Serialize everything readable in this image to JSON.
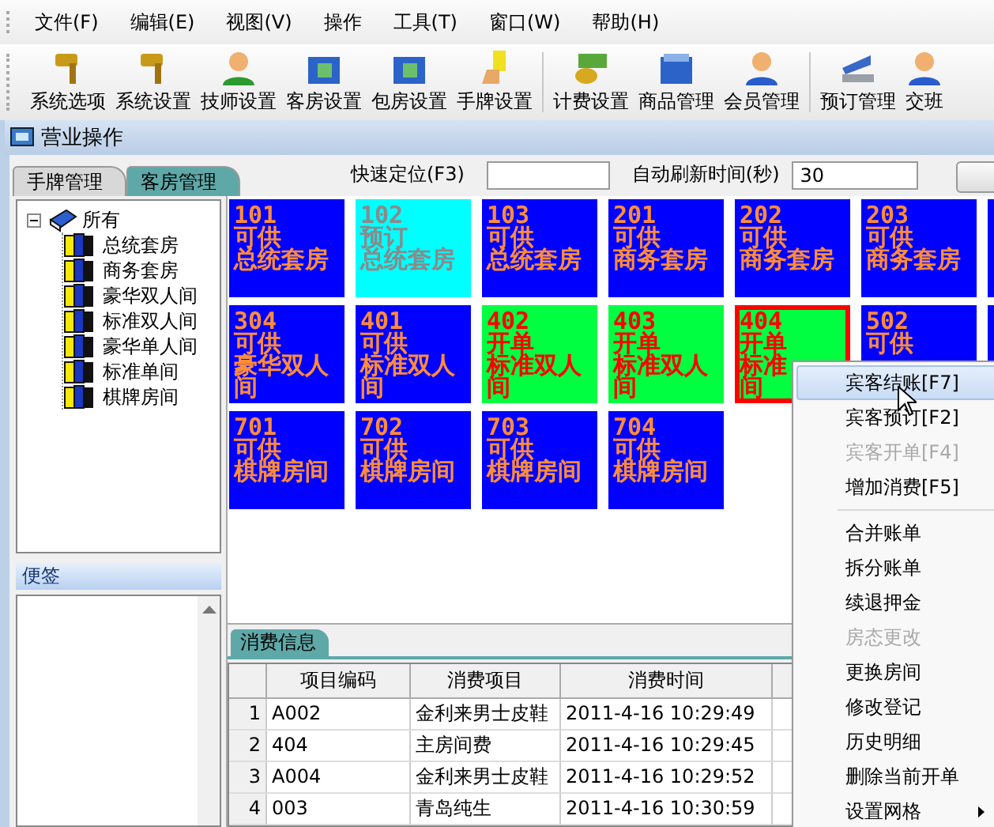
{
  "menu_bar": [
    {
      "label": "文件(F)"
    },
    {
      "label": "编辑(E)"
    },
    {
      "label": "视图(V)"
    },
    {
      "label": "操作"
    },
    {
      "label": "工具(T)"
    },
    {
      "label": "窗口(W)"
    },
    {
      "label": "帮助(H)"
    }
  ],
  "toolbar": [
    {
      "label": "系统选项",
      "separator_before": false
    },
    {
      "label": "系统设置",
      "separator_before": false
    },
    {
      "label": "技师设置",
      "separator_before": false
    },
    {
      "label": "客房设置",
      "separator_before": false
    },
    {
      "label": "包房设置",
      "separator_before": false
    },
    {
      "label": "手牌设置",
      "separator_before": false
    },
    {
      "label": "计费设置",
      "separator_before": true
    },
    {
      "label": "商品管理",
      "separator_before": false
    },
    {
      "label": "会员管理",
      "separator_before": false
    },
    {
      "label": "预订管理",
      "separator_before": true
    },
    {
      "label": "交班",
      "separator_before": false
    }
  ],
  "window": {
    "title": "营业操作"
  },
  "tabs": [
    {
      "label": "手牌管理",
      "selected": false
    },
    {
      "label": "客房管理",
      "selected": true
    }
  ],
  "quick_locate": {
    "label": "快速定位(F3)"
  },
  "auto_refresh": {
    "label": "自动刷新时间(秒)",
    "value": "30"
  },
  "tree": {
    "label": "所有",
    "expanded": true,
    "children": [
      {
        "label": "总统套房"
      },
      {
        "label": "商务套房"
      },
      {
        "label": "豪华双人间"
      },
      {
        "label": "标准双人间"
      },
      {
        "label": "豪华单人间"
      },
      {
        "label": "标准单间"
      },
      {
        "label": "棋牌房间"
      }
    ]
  },
  "notes": {
    "title": "便签"
  },
  "rooms": [
    {
      "lines": [
        "101",
        "可供",
        "总统套房"
      ],
      "kind": "available",
      "selected": false
    },
    {
      "lines": [
        "102",
        "预订",
        "总统套房"
      ],
      "kind": "reserved",
      "selected": false
    },
    {
      "lines": [
        "103",
        "可供",
        "总统套房"
      ],
      "kind": "available",
      "selected": false
    },
    {
      "lines": [
        "201",
        "可供",
        "商务套房"
      ],
      "kind": "available",
      "selected": false
    },
    {
      "lines": [
        "202",
        "可供",
        "商务套房"
      ],
      "kind": "available",
      "selected": false
    },
    {
      "lines": [
        "203",
        "可供",
        "商务套房"
      ],
      "kind": "available",
      "selected": false
    },
    {
      "kind": "available",
      "selected": false
    },
    {
      "lines": [
        "304",
        "可供",
        "豪华双人",
        "间"
      ],
      "kind": "available",
      "selected": false
    },
    {
      "lines": [
        "401",
        "可供",
        "标准双人",
        "间"
      ],
      "kind": "available",
      "selected": false
    },
    {
      "lines": [
        "402",
        "开单",
        "标准双人",
        "间"
      ],
      "kind": "open",
      "selected": false
    },
    {
      "lines": [
        "403",
        "开单",
        "标准双人",
        "间"
      ],
      "kind": "open",
      "selected": false
    },
    {
      "lines": [
        "404",
        "开单",
        "标准",
        "间"
      ],
      "kind": "open",
      "selected": true
    },
    {
      "lines": [
        "502",
        "可供"
      ],
      "kind": "available",
      "selected": false
    },
    {
      "kind": "available",
      "selected": false
    },
    {
      "lines": [
        "701",
        "可供",
        "棋牌房间"
      ],
      "kind": "available",
      "selected": false
    },
    {
      "lines": [
        "702",
        "可供",
        "棋牌房间"
      ],
      "kind": "available",
      "selected": false
    },
    {
      "lines": [
        "703",
        "可供",
        "棋牌房间"
      ],
      "kind": "available",
      "selected": false
    },
    {
      "lines": [
        "704",
        "可供",
        "棋牌房间"
      ],
      "kind": "available",
      "selected": false
    }
  ],
  "consumption": {
    "tab": "消费信息",
    "columns": [
      "项目编码",
      "消费项目",
      "消费时间"
    ],
    "rows": [
      {
        "index": "1",
        "cells": [
          "A002",
          "金利来男士皮鞋",
          "2011-4-16 10:29:49"
        ]
      },
      {
        "index": "2",
        "cells": [
          "404",
          "主房间费",
          "2011-4-16 10:29:45"
        ]
      },
      {
        "index": "3",
        "cells": [
          "A004",
          "金利来男士皮鞋",
          "2011-4-16 10:29:52"
        ]
      },
      {
        "index": "4",
        "cells": [
          "003",
          "青岛纯生",
          "2011-4-16 10:30:59"
        ]
      }
    ]
  },
  "context_menu": [
    {
      "kind": "item",
      "label": "宾客结账[F7]",
      "selected": true,
      "disabled": false,
      "submenu": false
    },
    {
      "kind": "item",
      "label": "宾客预订[F2]",
      "selected": false,
      "disabled": false,
      "submenu": false
    },
    {
      "kind": "item",
      "label": "宾客开单[F4]",
      "selected": false,
      "disabled": true,
      "submenu": false
    },
    {
      "kind": "item",
      "label": "增加消费[F5]",
      "selected": false,
      "disabled": false,
      "submenu": false
    },
    {
      "kind": "separator"
    },
    {
      "kind": "item",
      "label": "合并账单",
      "selected": false,
      "disabled": false,
      "submenu": false
    },
    {
      "kind": "item",
      "label": "拆分账单",
      "selected": false,
      "disabled": false,
      "submenu": false
    },
    {
      "kind": "item",
      "label": "续退押金",
      "selected": false,
      "disabled": false,
      "submenu": false
    },
    {
      "kind": "item",
      "label": "房态更改",
      "selected": false,
      "disabled": true,
      "submenu": false
    },
    {
      "kind": "item",
      "label": "更换房间",
      "selected": false,
      "disabled": false,
      "submenu": false
    },
    {
      "kind": "item",
      "label": "修改登记",
      "selected": false,
      "disabled": false,
      "submenu": false
    },
    {
      "kind": "item",
      "label": "历史明细",
      "selected": false,
      "disabled": false,
      "submenu": false
    },
    {
      "kind": "item",
      "label": "删除当前开单",
      "selected": false,
      "disabled": false,
      "submenu": false
    },
    {
      "kind": "item",
      "label": "设置网格",
      "selected": false,
      "disabled": false,
      "submenu": true
    }
  ]
}
